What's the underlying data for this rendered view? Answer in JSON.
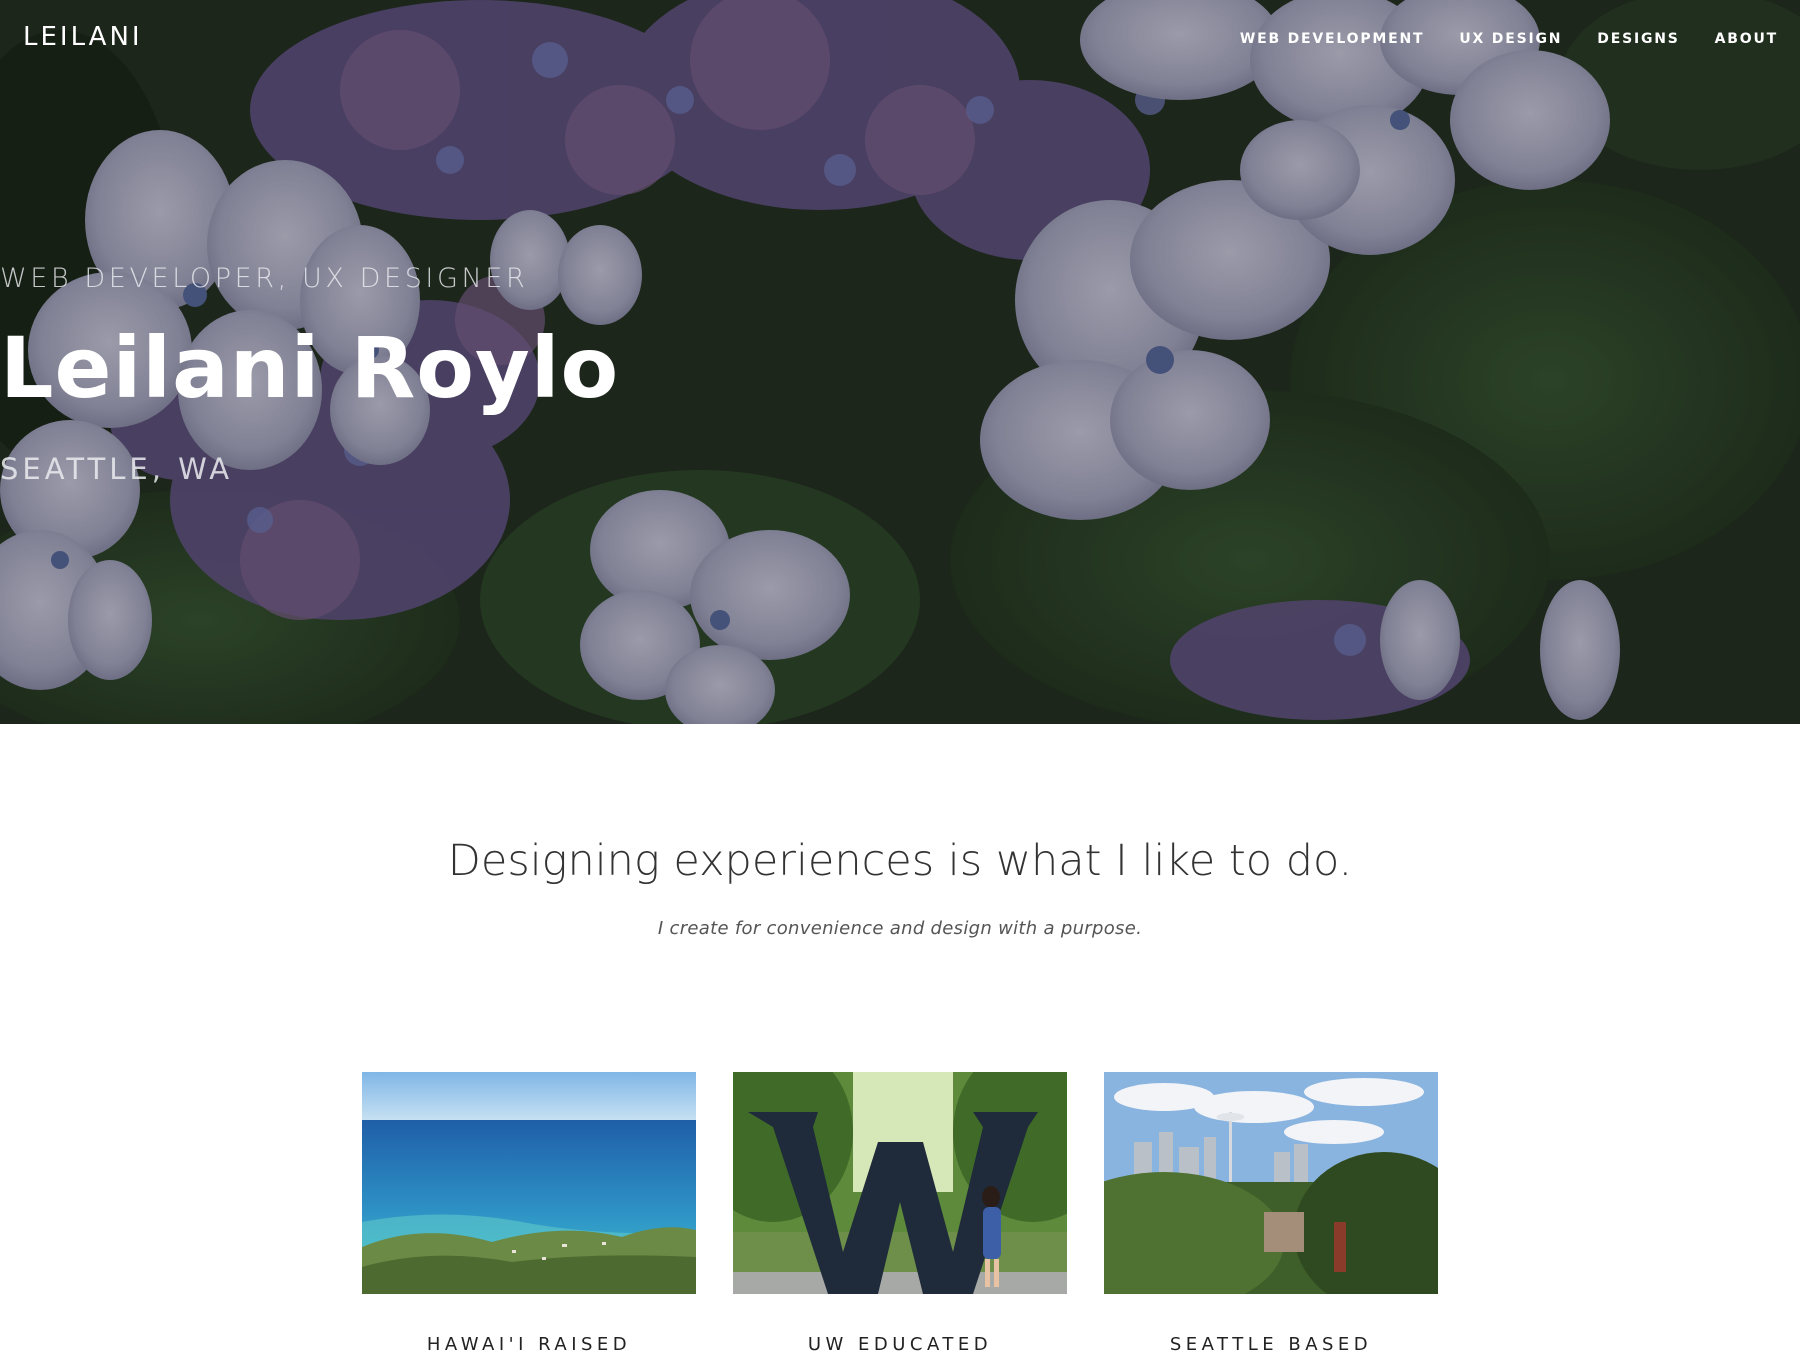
{
  "site": {
    "logo": "LEILANI"
  },
  "nav": {
    "items": [
      {
        "label": "WEB DEVELOPMENT"
      },
      {
        "label": "UX DESIGN"
      },
      {
        "label": "DESIGNS"
      },
      {
        "label": "ABOUT"
      }
    ]
  },
  "hero": {
    "eyebrow": "WEB DEVELOPER, UX DESIGNER",
    "name": "Leilani Roylo",
    "location": "SEATTLE, WA",
    "background": "hydrangea-flowers-photo"
  },
  "intro": {
    "heading": "Designing experiences is what I like to do.",
    "subheading": "I create for convenience and design with a purpose."
  },
  "cards": [
    {
      "label": "HAWAI'I RAISED",
      "image": "hawaii-coastline-photo"
    },
    {
      "label": "UW EDUCATED",
      "image": "uw-w-statue-photo"
    },
    {
      "label": "SEATTLE BASED",
      "image": "seattle-skyline-photo"
    }
  ]
}
